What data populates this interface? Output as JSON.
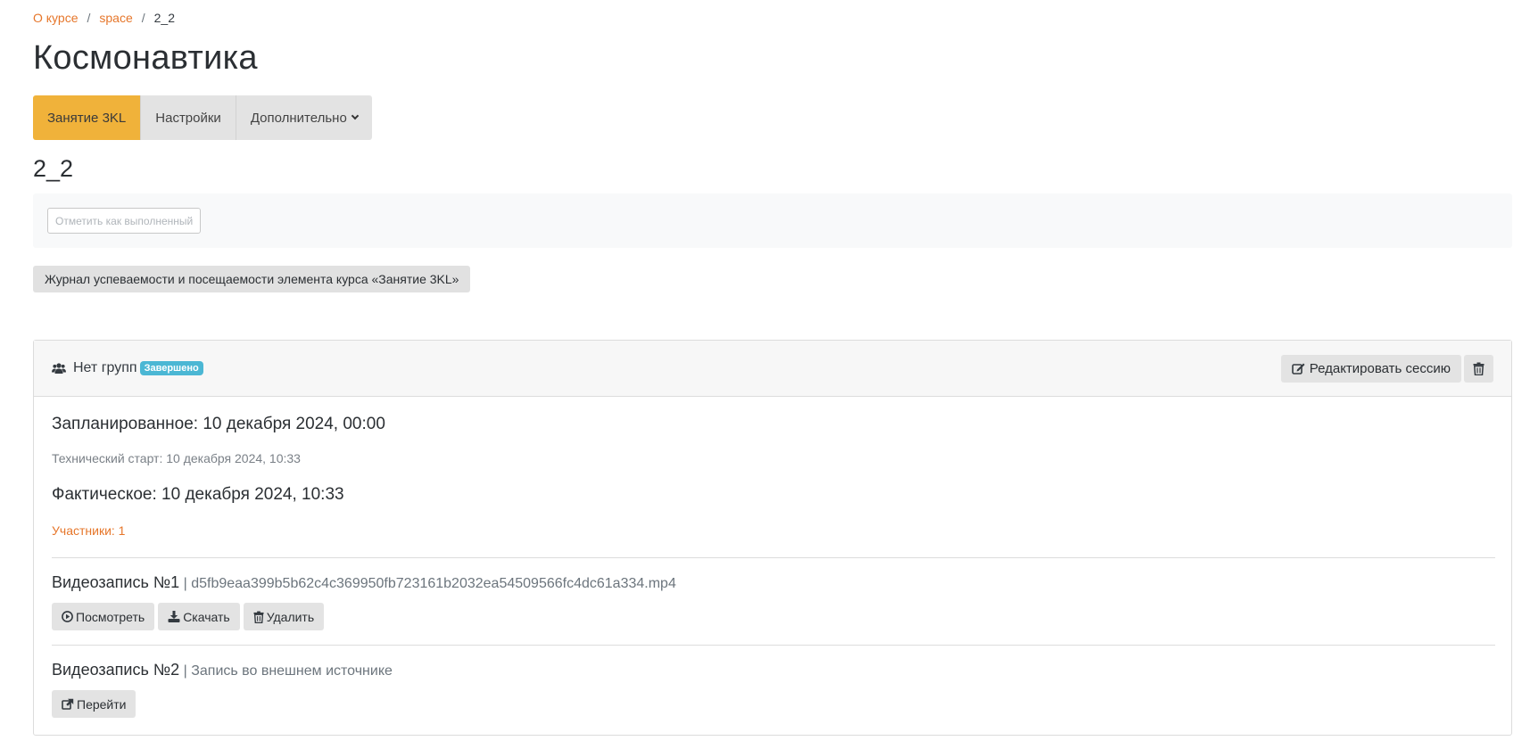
{
  "breadcrumb": {
    "home": "О курсе",
    "course": "space",
    "current": "2_2"
  },
  "page_title": "Космонавтика",
  "tabs": [
    {
      "label": "Занятие 3KL"
    },
    {
      "label": "Настройки"
    },
    {
      "label": "Дополнительно"
    }
  ],
  "section_title": "2_2",
  "completion": {
    "button_label": "Отметить как выполненный"
  },
  "journal_button": "Журнал успеваемости и посещаемости элемента курса «Занятие 3KL»",
  "session": {
    "group_label": "Нет групп",
    "status_badge": "Завершено",
    "edit_button": "Редактировать сессию",
    "planned": "Запланированное: 10 декабря 2024, 00:00",
    "tech_start": "Технический старт: 10 декабря 2024, 10:33",
    "actual": "Фактическое: 10 декабря 2024, 10:33",
    "participants": "Участники: 1",
    "recordings": [
      {
        "title": "Видеозапись №1",
        "subtitle": "| d5fb9eaa399b5b62c4c369950fb723161b2032ea54509566fc4dc61a334.mp4",
        "actions": [
          "Посмотреть",
          "Скачать",
          "Удалить"
        ]
      },
      {
        "title": "Видеозапись №2",
        "subtitle": "| Запись во внешнем источнике",
        "actions": [
          "Перейти"
        ]
      }
    ]
  },
  "colors": {
    "accent": "#f0b23a",
    "link": "#e6762a",
    "badge": "#4bb7d4"
  }
}
